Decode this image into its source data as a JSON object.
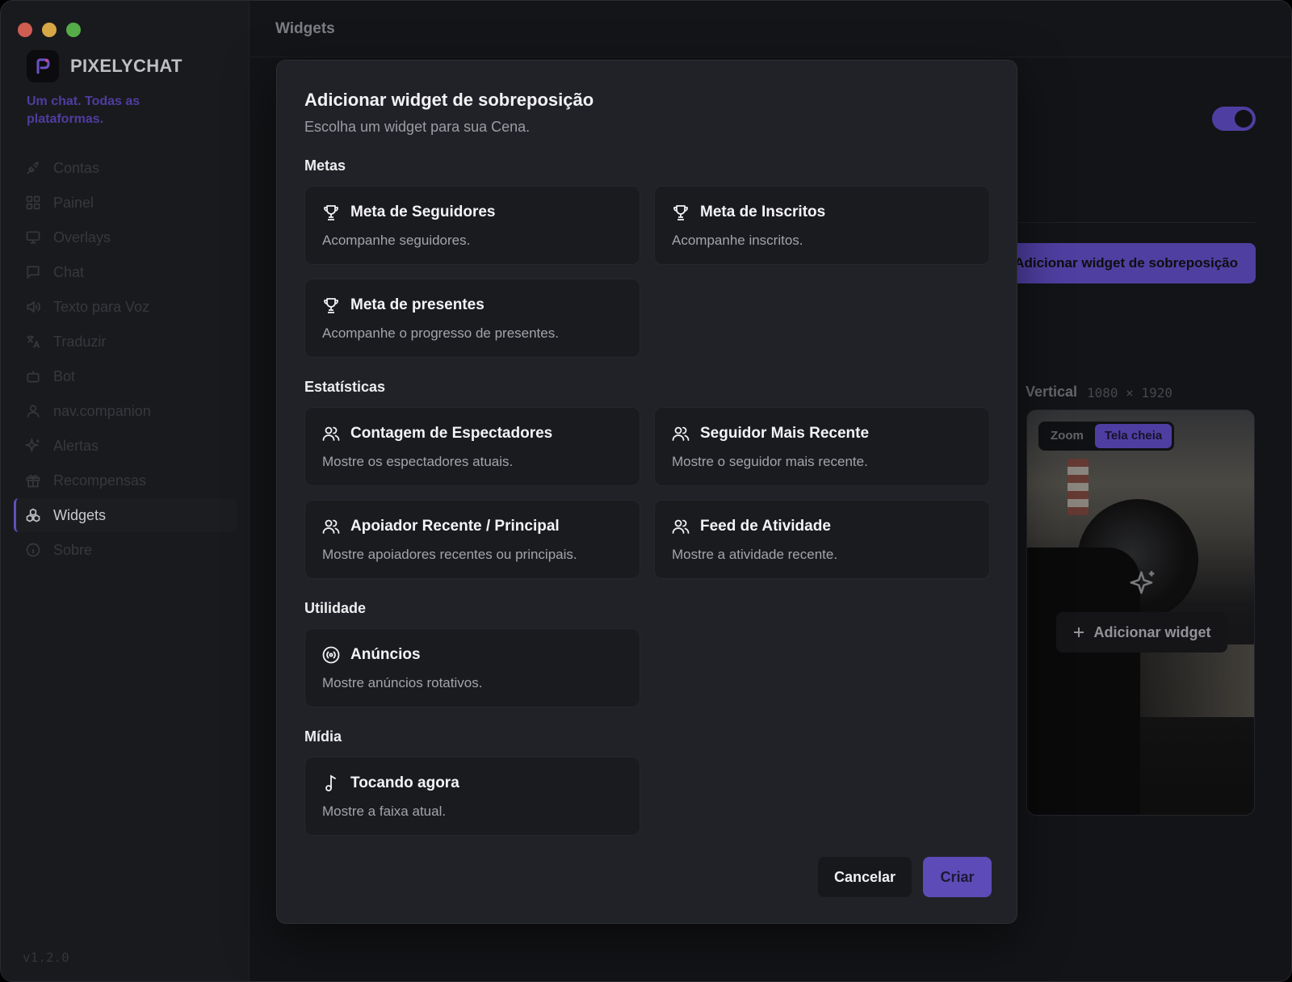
{
  "sidebar": {
    "brand": "PIXELYCHAT",
    "tagline": "Um chat. Todas as plataformas.",
    "items": [
      {
        "label": "Contas",
        "icon": "plug-icon"
      },
      {
        "label": "Painel",
        "icon": "grid-icon"
      },
      {
        "label": "Overlays",
        "icon": "monitor-icon"
      },
      {
        "label": "Chat",
        "icon": "chat-icon"
      },
      {
        "label": "Texto para Voz",
        "icon": "speaker-icon"
      },
      {
        "label": "Traduzir",
        "icon": "translate-icon"
      },
      {
        "label": "Bot",
        "icon": "bot-icon"
      },
      {
        "label": "nav.companion",
        "icon": "user-icon"
      },
      {
        "label": "Alertas",
        "icon": "sparkle-icon"
      },
      {
        "label": "Recompensas",
        "icon": "gift-icon"
      },
      {
        "label": "Widgets",
        "icon": "widgets-icon",
        "active": true
      },
      {
        "label": "Sobre",
        "icon": "info-icon"
      }
    ],
    "version": "v1.2.0"
  },
  "header": {
    "title": "Widgets"
  },
  "background": {
    "add_overlay_button": "Adicionar widget de sobreposição",
    "vertical_label": "Vertical",
    "vertical_dims": "1080 × 1920",
    "preview_modes": [
      "Zoom",
      "Tela cheia"
    ],
    "preview_selected": "Tela cheia",
    "preview_add_widget": "Adicionar widget"
  },
  "modal": {
    "title": "Adicionar widget de sobreposição",
    "subtitle": "Escolha um widget para sua Cena.",
    "sections": {
      "metas": {
        "title": "Metas",
        "cards": [
          {
            "title": "Meta de Seguidores",
            "desc": "Acompanhe seguidores.",
            "icon": "trophy-icon"
          },
          {
            "title": "Meta de Inscritos",
            "desc": "Acompanhe inscritos.",
            "icon": "trophy-icon"
          },
          {
            "title": "Meta de presentes",
            "desc": "Acompanhe o progresso de presentes.",
            "icon": "trophy-icon"
          }
        ]
      },
      "estatisticas": {
        "title": "Estatísticas",
        "cards": [
          {
            "title": "Contagem de Espectadores",
            "desc": "Mostre os espectadores atuais.",
            "icon": "users-icon"
          },
          {
            "title": "Seguidor Mais Recente",
            "desc": "Mostre o seguidor mais recente.",
            "icon": "users-icon"
          },
          {
            "title": "Apoiador Recente / Principal",
            "desc": "Mostre apoiadores recentes ou principais.",
            "icon": "users-icon"
          },
          {
            "title": "Feed de Atividade",
            "desc": "Mostre a atividade recente.",
            "icon": "users-icon"
          }
        ]
      },
      "utilidade": {
        "title": "Utilidade",
        "cards": [
          {
            "title": "Anúncios",
            "desc": "Mostre anúncios rotativos.",
            "icon": "broadcast-icon"
          }
        ]
      },
      "midia": {
        "title": "Mídia",
        "cards": [
          {
            "title": "Tocando agora",
            "desc": "Mostre a faixa atual.",
            "icon": "music-note-icon"
          }
        ]
      }
    },
    "cancel_label": "Cancelar",
    "create_label": "Criar"
  },
  "colors": {
    "accent": "#5d4bb7",
    "window_bg": "#16171b",
    "sidebar_bg": "#1d1e22",
    "modal_bg": "#212227",
    "card_bg": "#1a1b1f"
  }
}
